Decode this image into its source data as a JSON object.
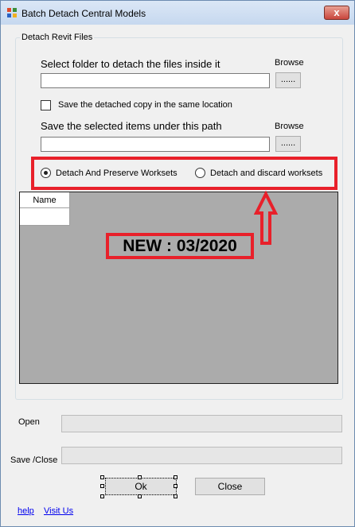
{
  "window": {
    "title": "Batch  Detach Central Models",
    "close_glyph": "x",
    "icon": "app-icon"
  },
  "group": {
    "legend": "Detach Revit Files"
  },
  "folder_section": {
    "label": "Select  folder to detach the files inside it",
    "browse_label": "Browse",
    "path_value": "",
    "browse_button": "......"
  },
  "same_location": {
    "label": "Save the detached copy in the same location",
    "checked": false
  },
  "save_section": {
    "label": "Save the selected items under this path",
    "browse_label": "Browse",
    "path_value": "",
    "browse_button": "......"
  },
  "worksets": {
    "options": [
      {
        "label": "Detach And Preserve Worksets",
        "selected": true
      },
      {
        "label": "Detach and discard worksets",
        "selected": false
      }
    ]
  },
  "grid": {
    "columns": [
      "Name"
    ]
  },
  "annotation": {
    "text": "NEW : 03/2020",
    "color": "#e8202a"
  },
  "progress": {
    "open_label": "Open",
    "save_close_label": "Save /Close",
    "open_value": 0,
    "save_close_value": 0
  },
  "buttons": {
    "ok": "Ok",
    "close": "Close"
  },
  "links": {
    "help": "help",
    "visit": "Visit Us"
  }
}
